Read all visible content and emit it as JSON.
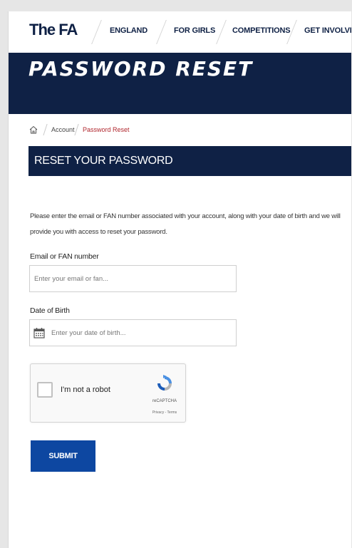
{
  "header": {
    "logo": "The FA",
    "nav": [
      "ENGLAND",
      "FOR GIRLS",
      "COMPETITIONS",
      "GET INVOLVED"
    ]
  },
  "hero": {
    "title": "PASSWORD RESET"
  },
  "breadcrumb": {
    "home_icon": "home-icon",
    "items": [
      "Account",
      "Password Reset"
    ]
  },
  "section": {
    "title": "RESET YOUR PASSWORD"
  },
  "intro_text": "Please enter the email or FAN number associated with your account, along with your date of birth and we will provide you with access to reset your password.",
  "form": {
    "email_label": "Email or FAN number",
    "email_placeholder": "Enter your email or fan...",
    "email_value": "",
    "dob_label": "Date of Birth",
    "dob_placeholder": "Enter your date of birth...",
    "dob_value": "",
    "dob_icon": "calendar-icon",
    "captcha_label": "I'm not a robot",
    "captcha_brand": "reCAPTCHA",
    "captcha_links": "Privacy - Terms",
    "submit_label": "SUBMIT"
  },
  "colors": {
    "navy": "#0f2145",
    "button_blue": "#0d47a1",
    "breadcrumb_active": "#b0262d"
  }
}
